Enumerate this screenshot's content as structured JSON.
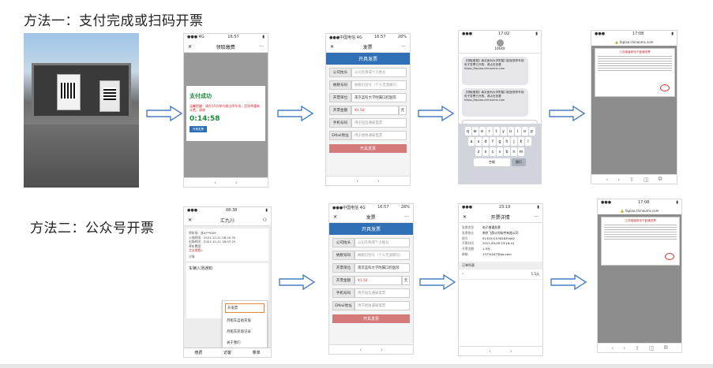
{
  "method1": {
    "title": "方法一：支付完成或扫码开票"
  },
  "method2": {
    "title": "方法二：公众号开票"
  },
  "pay_screen": {
    "nav_title": "领取缴费",
    "success_title": "支付成功",
    "notice": "温馨提醒：请在15分钟内驶出停车场，否则将重新计费，谢谢",
    "countdown": "0:14:58",
    "invoice_btn": "开具发票"
  },
  "invoice_form": {
    "nav_title": "发票",
    "header": "开具发票",
    "fields": [
      {
        "label": "公司抬头",
        "value": "公司名称或个人姓名"
      },
      {
        "label": "纳税号码",
        "value": "纳税识别号（个人无须填写）"
      },
      {
        "label": "开票单位",
        "value": "南京蓝科大学附属口腔医院"
      },
      {
        "label": "开票金额",
        "value": "¥1.50",
        "unit": "元"
      },
      {
        "label": "手机号码",
        "value": "用于短信通知电票"
      },
      {
        "label": "EMail地址",
        "value": "用于接收通知电票"
      }
    ],
    "submit": "开具发票"
  },
  "sms_screen": {
    "sender": "106XX",
    "msg1": "【领取缴费】南京医科大学附属口腔医院停车场电子发票已开具，请点击查看 https://fapiao.chinaums.com",
    "msg2": "【领取缴费】南京医科大学附属口腔医院停车场电子发票已开具，请点击查看 https://fapiao.chinaums.com",
    "keys_row1": [
      "q",
      "w",
      "e",
      "r",
      "t",
      "y",
      "u",
      "i",
      "o",
      "p"
    ],
    "keys_row2": [
      "a",
      "s",
      "d",
      "f",
      "g",
      "h",
      "j",
      "k",
      "l"
    ],
    "keys_row3": [
      "z",
      "x",
      "c",
      "v",
      "b",
      "n",
      "m"
    ],
    "space": "空格",
    "return": "换行"
  },
  "pdf_screen": {
    "url": "fapiao.chinaums.com",
    "doc_title": "江苏增值税电子普通发票"
  },
  "wechat_screen": {
    "nav_title": "汇九川",
    "plate": "停车场：苏A***D8Y",
    "entry": "入场时间：2021-10-21 08:20:35",
    "exit": "出场时间：2021-10-21 18:07:25",
    "fee_label": "停车费用：",
    "click": "点击查看>",
    "notice_title": "车辆入场通知",
    "detail": "详情",
    "menu": [
      "开发票",
      "月租车自助充值",
      "月租车充值记录",
      "关于我们"
    ],
    "bottom": [
      "缴费",
      "访客",
      "菜单"
    ]
  },
  "detail_screen": {
    "nav_title": "开票详情",
    "rows": [
      {
        "k": "发票类型",
        "v": "电子普通发票"
      },
      {
        "k": "发票抬头",
        "v": "南京飞鸽计时软件有限公司"
      },
      {
        "k": "税号",
        "v": "91320115302639482"
      },
      {
        "k": "开票时间",
        "v": "2021-09-09 23:18:41"
      },
      {
        "k": "开票金额",
        "v": "1.5元"
      },
      {
        "k": "邮箱",
        "v": "1373s247@qq.com"
      }
    ],
    "section": "订单列表",
    "order_amount": "1.5元"
  }
}
